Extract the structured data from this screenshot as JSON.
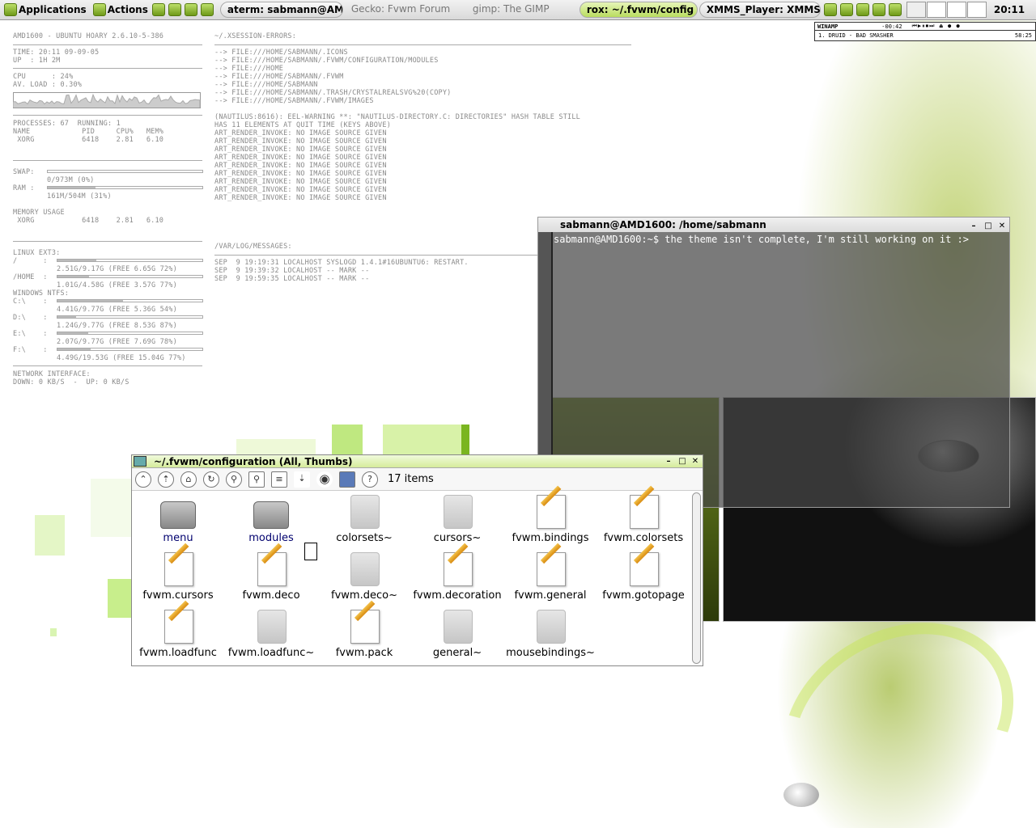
{
  "panel": {
    "applications": "Applications",
    "actions": "Actions",
    "clock": "20:11",
    "tasks": [
      "aterm: sabmann@AM",
      "Gecko: Fvwm Forum",
      "gimp: The GIMP",
      "rox: ~/.fvwm/config",
      "XMMS_Player: XMMS"
    ]
  },
  "conky": {
    "host": "AMD1600 - UBUNTU HOARY 2.6.10-5-386",
    "time": "TIME: 20:11 09-09-05",
    "up": "UP  : 1H 2M",
    "cpu": "CPU      : 24%",
    "load": "AV. LOAD : 0.30%",
    "processes": "PROCESSES: 67  RUNNING: 1",
    "proc_header": "NAME            PID     CPU%   MEM%",
    "proc_row": " XORG           6418    2.81   6.10",
    "swap": "SWAP:",
    "swap_val": "0/973M (0%)",
    "ram": "RAM :",
    "ram_val": "161M/504M (31%)",
    "mem_usage": "MEMORY USAGE",
    "mem_row": " XORG           6418    2.81   6.10",
    "linux": "LINUX EXT3:",
    "root": "/      :",
    "root_val": "2.51G/9.17G (FREE 6.65G 72%)",
    "home": "/HOME  :",
    "home_val": "1.01G/4.58G (FREE 3.57G 77%)",
    "win": "WINDOWS NTFS:",
    "c": "C:\\    :",
    "c_val": "4.41G/9.77G (FREE 5.36G 54%)",
    "d": "D:\\    :",
    "d_val": "1.24G/9.77G (FREE 8.53G 87%)",
    "e": "E:\\    :",
    "e_val": "2.07G/9.77G (FREE 7.69G 78%)",
    "f": "F:\\    :",
    "f_val": "4.49G/19.53G (FREE 15.04G 77%)",
    "net": "NETWORK INTERFACE:",
    "net_val": "DOWN: 0 KB/S  -  UP: 0 KB/S",
    "xsession_title": "~/.XSESSION-ERRORS:",
    "xsession": "--> FILE:///HOME/SABMANN/.ICONS\n--> FILE:///HOME/SABMANN/.FVWM/CONFIGURATION/MODULES\n--> FILE:///HOME\n--> FILE:///HOME/SABMANN/.FVWM\n--> FILE:///HOME/SABMANN\n--> FILE:///HOME/SABMANN/.TRASH/CRYSTALREALSVG%20(COPY)\n--> FILE:///HOME/SABMANN/.FVWM/IMAGES\n\n(NAUTILUS:8616): EEL-WARNING **: \"NAUTILUS-DIRECTORY.C: DIRECTORIES\" HASH TABLE STILL\nHAS 11 ELEMENTS AT QUIT TIME (KEYS ABOVE)\nART_RENDER_INVOKE: NO IMAGE SOURCE GIVEN\nART_RENDER_INVOKE: NO IMAGE SOURCE GIVEN\nART_RENDER_INVOKE: NO IMAGE SOURCE GIVEN\nART_RENDER_INVOKE: NO IMAGE SOURCE GIVEN\nART_RENDER_INVOKE: NO IMAGE SOURCE GIVEN\nART_RENDER_INVOKE: NO IMAGE SOURCE GIVEN\nART_RENDER_INVOKE: NO IMAGE SOURCE GIVEN\nART_RENDER_INVOKE: NO IMAGE SOURCE GIVEN\nART_RENDER_INVOKE: NO IMAGE SOURCE GIVEN",
    "messages_title": "/VAR/LOG/MESSAGES:",
    "messages": "SEP  9 19:19:31 LOCALHOST SYSLOGD 1.4.1#16UBUNTU6: RESTART.\nSEP  9 19:39:32 LOCALHOST -- MARK --\nSEP  9 19:59:35 LOCALHOST -- MARK --"
  },
  "levels": {
    "cpu": 0.24,
    "swap": 0.0,
    "ram": 0.31,
    "root": 0.27,
    "home": 0.22,
    "c": 0.45,
    "d": 0.13,
    "e": 0.21,
    "f": 0.23
  },
  "winamp": {
    "title": "WINAMP",
    "time": "-00:42",
    "track": "1. DRUID - BAD SMASHER",
    "length": "58:25"
  },
  "terminal": {
    "title": "sabmann@AMD1600: /home/sabmann",
    "prompt": "sabmann@AMD1600:~$ ",
    "text": "the theme isn't complete, I'm still working on it :>"
  },
  "rox": {
    "title": "~/.fvwm/configuration (All, Thumbs)",
    "count": "17 items",
    "files": [
      {
        "name": "menu",
        "kind": "dir"
      },
      {
        "name": "modules",
        "kind": "dir"
      },
      {
        "name": "colorsets~",
        "kind": "ghost"
      },
      {
        "name": "cursors~",
        "kind": "ghost"
      },
      {
        "name": "fvwm.bindings",
        "kind": "doc"
      },
      {
        "name": "fvwm.colorsets",
        "kind": "doc"
      },
      {
        "name": "fvwm.cursors",
        "kind": "doc"
      },
      {
        "name": "fvwm.deco",
        "kind": "doc"
      },
      {
        "name": "fvwm.deco~",
        "kind": "ghost"
      },
      {
        "name": "fvwm.decoration",
        "kind": "doc"
      },
      {
        "name": "fvwm.general",
        "kind": "doc"
      },
      {
        "name": "fvwm.gotopage",
        "kind": "doc"
      },
      {
        "name": "fvwm.loadfunc",
        "kind": "doc"
      },
      {
        "name": "fvwm.loadfunc~",
        "kind": "ghost"
      },
      {
        "name": "fvwm.pack",
        "kind": "doc"
      },
      {
        "name": "general~",
        "kind": "ghost"
      },
      {
        "name": "mousebindings~",
        "kind": "ghost"
      }
    ]
  },
  "colors": {
    "accent": "#a8d040",
    "panel": "#e2e2e2"
  }
}
